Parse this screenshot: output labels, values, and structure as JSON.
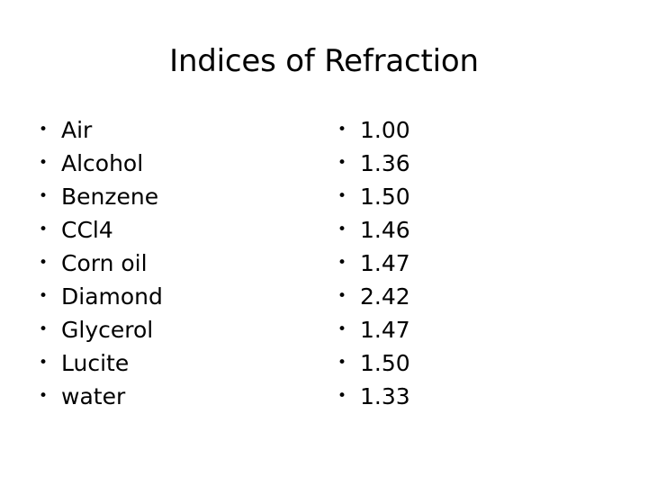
{
  "slide": {
    "title": "Indices of Refraction",
    "background_color": "#ffffff",
    "text_color": "#000000",
    "bullet_glyph": "•",
    "columns": {
      "left": {
        "name": "materials",
        "items": [
          {
            "label": "Air"
          },
          {
            "label": "Alcohol"
          },
          {
            "label": "Benzene"
          },
          {
            "label": "CCl4"
          },
          {
            "label": "Corn oil"
          },
          {
            "label": "Diamond"
          },
          {
            "label": "Glycerol"
          },
          {
            "label": "Lucite"
          },
          {
            "label": "water"
          }
        ]
      },
      "right": {
        "name": "index-values",
        "items": [
          {
            "label": "1.00"
          },
          {
            "label": "1.36"
          },
          {
            "label": "1.50"
          },
          {
            "label": "1.46"
          },
          {
            "label": "1.47"
          },
          {
            "label": "2.42"
          },
          {
            "label": "1.47"
          },
          {
            "label": "1.50"
          },
          {
            "label": "1.33"
          }
        ]
      }
    }
  }
}
